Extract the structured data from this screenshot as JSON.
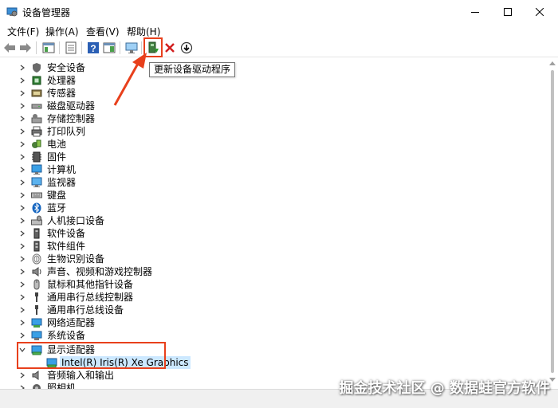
{
  "window": {
    "title": "设备管理器"
  },
  "menu": [
    "文件(F)",
    "操作(A)",
    "查看(V)",
    "帮助(H)"
  ],
  "tooltip": "更新设备驱动程序",
  "colors": {
    "highlight": "#e8401c",
    "selection": "#cce8ff",
    "tooltip_border": "#767676"
  },
  "tree": [
    {
      "label": "安全设备",
      "icon": "shield-icon",
      "expanded": false
    },
    {
      "label": "处理器",
      "icon": "cpu-icon",
      "expanded": false
    },
    {
      "label": "传感器",
      "icon": "sensor-icon",
      "expanded": false
    },
    {
      "label": "磁盘驱动器",
      "icon": "disk-icon",
      "expanded": false
    },
    {
      "label": "存储控制器",
      "icon": "storage-icon",
      "expanded": false
    },
    {
      "label": "打印队列",
      "icon": "printer-icon",
      "expanded": false
    },
    {
      "label": "电池",
      "icon": "battery-icon",
      "expanded": false
    },
    {
      "label": "固件",
      "icon": "firmware-icon",
      "expanded": false
    },
    {
      "label": "计算机",
      "icon": "computer-icon",
      "expanded": false
    },
    {
      "label": "监视器",
      "icon": "monitor-icon",
      "expanded": false
    },
    {
      "label": "键盘",
      "icon": "keyboard-icon",
      "expanded": false
    },
    {
      "label": "蓝牙",
      "icon": "bluetooth-icon",
      "expanded": false
    },
    {
      "label": "人机接口设备",
      "icon": "hid-icon",
      "expanded": false
    },
    {
      "label": "软件设备",
      "icon": "software-device-icon",
      "expanded": false
    },
    {
      "label": "软件组件",
      "icon": "software-component-icon",
      "expanded": false
    },
    {
      "label": "生物识别设备",
      "icon": "fingerprint-icon",
      "expanded": false
    },
    {
      "label": "声音、视频和游戏控制器",
      "icon": "speaker-icon",
      "expanded": false
    },
    {
      "label": "鼠标和其他指针设备",
      "icon": "mouse-icon",
      "expanded": false
    },
    {
      "label": "通用串行总线控制器",
      "icon": "usb-icon",
      "expanded": false
    },
    {
      "label": "通用串行总线设备",
      "icon": "usb-icon",
      "expanded": false
    },
    {
      "label": "网络适配器",
      "icon": "network-icon",
      "expanded": false
    },
    {
      "label": "系统设备",
      "icon": "system-icon",
      "expanded": false
    },
    {
      "label": "显示适配器",
      "icon": "display-adapter-icon",
      "expanded": true
    },
    {
      "label": "Intel(R) Iris(R) Xe Graphics",
      "icon": "display-adapter-icon",
      "child": true,
      "selected": true
    },
    {
      "label": "音频输入和输出",
      "icon": "audio-icon",
      "expanded": false
    },
    {
      "label": "照相机",
      "icon": "camera-icon",
      "expanded": false
    }
  ],
  "watermark": "掘金技术社区 @ 数据蛙官方软件"
}
